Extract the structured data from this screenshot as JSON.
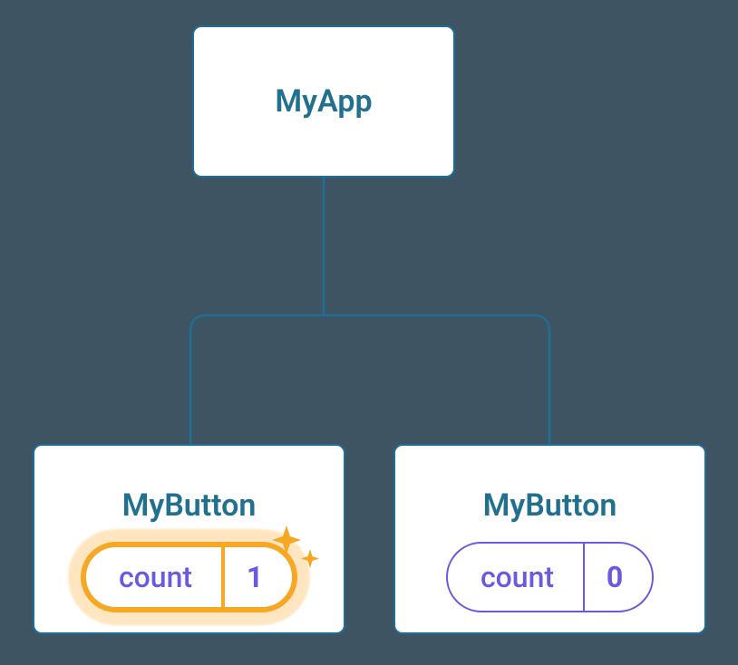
{
  "root": {
    "label": "MyApp"
  },
  "children": [
    {
      "label": "MyButton",
      "state_key": "count",
      "state_value": "1",
      "highlighted": true
    },
    {
      "label": "MyButton",
      "state_key": "count",
      "state_value": "0",
      "highlighted": false
    }
  ]
}
